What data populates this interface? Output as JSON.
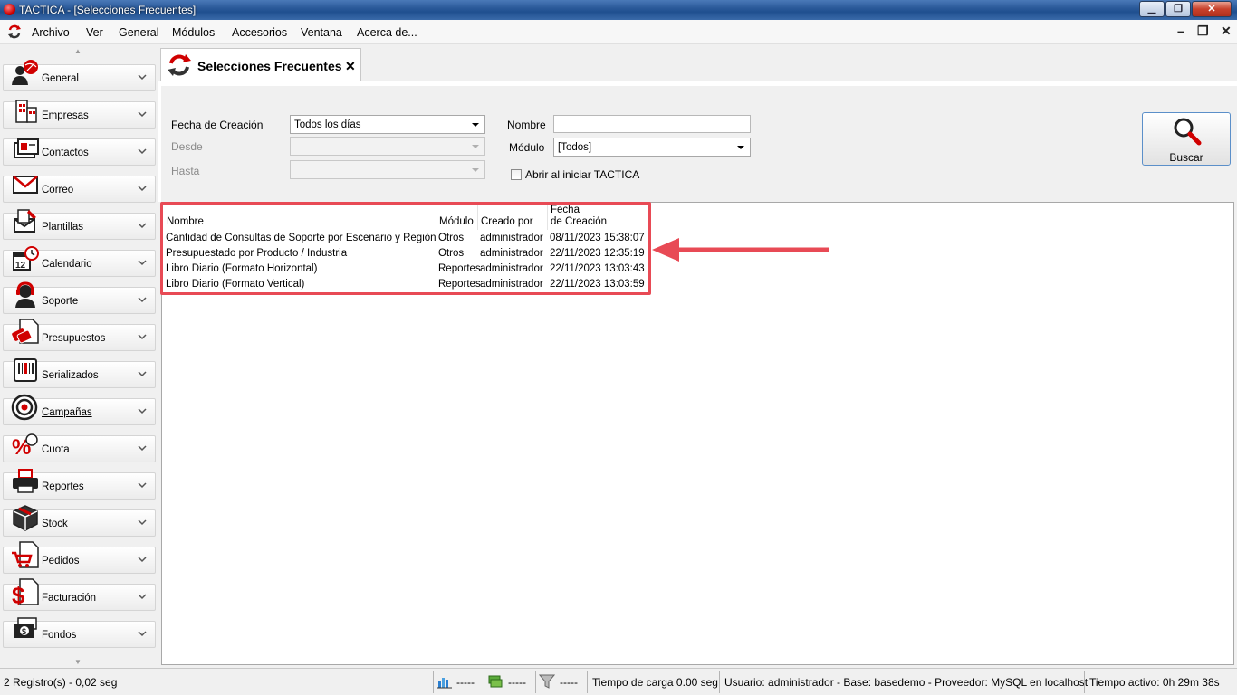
{
  "window": {
    "title": "TACTICA - [Selecciones Frecuentes]",
    "minimize": "▁",
    "maximize": "❐",
    "close": "✕"
  },
  "menu": {
    "items": [
      "Archivo",
      "Ver",
      "General",
      "Módulos",
      "Accesorios",
      "Ventana",
      "Acerca de..."
    ],
    "mdi_min": "–",
    "mdi_restore": "❐",
    "mdi_close": "✕"
  },
  "sidebar": {
    "items": [
      {
        "label": "General",
        "icon": "people-globe-icon"
      },
      {
        "label": "Empresas",
        "icon": "building-icon"
      },
      {
        "label": "Contactos",
        "icon": "contact-card-icon"
      },
      {
        "label": "Correo",
        "icon": "envelope-icon"
      },
      {
        "label": "Plantillas",
        "icon": "template-icon"
      },
      {
        "label": "Calendario",
        "icon": "calendar-icon"
      },
      {
        "label": "Soporte",
        "icon": "headset-icon"
      },
      {
        "label": "Presupuestos",
        "icon": "budget-icon"
      },
      {
        "label": "Serializados",
        "icon": "barcode-icon"
      },
      {
        "label": "Campañas",
        "icon": "target-icon"
      },
      {
        "label": "Cuota",
        "icon": "percent-icon"
      },
      {
        "label": "Reportes",
        "icon": "printer-icon"
      },
      {
        "label": "Stock",
        "icon": "box-icon"
      },
      {
        "label": "Pedidos",
        "icon": "cart-icon"
      },
      {
        "label": "Facturación",
        "icon": "dollar-icon"
      },
      {
        "label": "Fondos",
        "icon": "money-icon"
      }
    ]
  },
  "tab": {
    "label": "Selecciones Frecuentes",
    "close": "✕"
  },
  "filters": {
    "fecha_label": "Fecha de Creación",
    "fecha_value": "Todos los días",
    "desde_label": "Desde",
    "hasta_label": "Hasta",
    "nombre_label": "Nombre",
    "nombre_value": "",
    "modulo_label": "Módulo",
    "modulo_value": "[Todos]",
    "abrir_label": "Abrir al iniciar TACTICA",
    "buscar_label": "Buscar"
  },
  "grid": {
    "headers": {
      "nombre": "Nombre",
      "modulo": "Módulo",
      "creado": "Creado por",
      "fecha_line1": "Fecha",
      "fecha_line2": "de Creación"
    },
    "rows": [
      {
        "nombre": "Cantidad de Consultas de Soporte por Escenario y Región",
        "modulo": "Otros",
        "creado": "administrador",
        "fecha": "08/11/2023 15:38:07"
      },
      {
        "nombre": "Presupuestado por Producto / Industria",
        "modulo": "Otros",
        "creado": "administrador",
        "fecha": "22/11/2023 12:35:19"
      },
      {
        "nombre": "Libro Diario (Formato Horizontal)",
        "modulo": "Reportes",
        "creado": "administrador",
        "fecha": "22/11/2023 13:03:43"
      },
      {
        "nombre": "Libro Diario (Formato Vertical)",
        "modulo": "Reportes",
        "creado": "administrador",
        "fecha": "22/11/2023 13:03:59"
      }
    ]
  },
  "status": {
    "registros": "2 Registro(s) - 0,02 seg",
    "s1": "-----",
    "s2": "-----",
    "s3": "-----",
    "carga": "Tiempo de carga 0.00 seg",
    "usuario": "Usuario: administrador - Base: basedemo - Proveedor: MySQL en localhost",
    "activo": "Tiempo activo: 0h 29m 38s"
  },
  "colors": {
    "accent_red": "#e84a55",
    "brand_red": "#d00000",
    "button_border": "#5b8fc9"
  }
}
